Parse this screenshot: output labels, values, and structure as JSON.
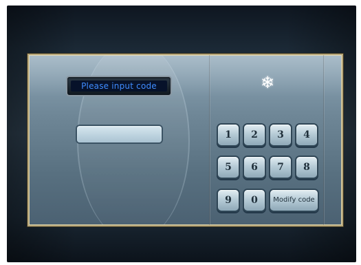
{
  "display": {
    "prompt": "Please input code"
  },
  "code_field": {
    "value": ""
  },
  "icons": {
    "status": "snowflake-icon"
  },
  "keypad": {
    "key_1": "1",
    "key_2": "2",
    "key_3": "3",
    "key_4": "4",
    "key_5": "5",
    "key_6": "6",
    "key_7": "7",
    "key_8": "8",
    "key_9": "9",
    "key_0": "0",
    "modify": "Modify code"
  },
  "colors": {
    "display_text": "#3f8cff",
    "panel_border": "#b9a87a"
  }
}
